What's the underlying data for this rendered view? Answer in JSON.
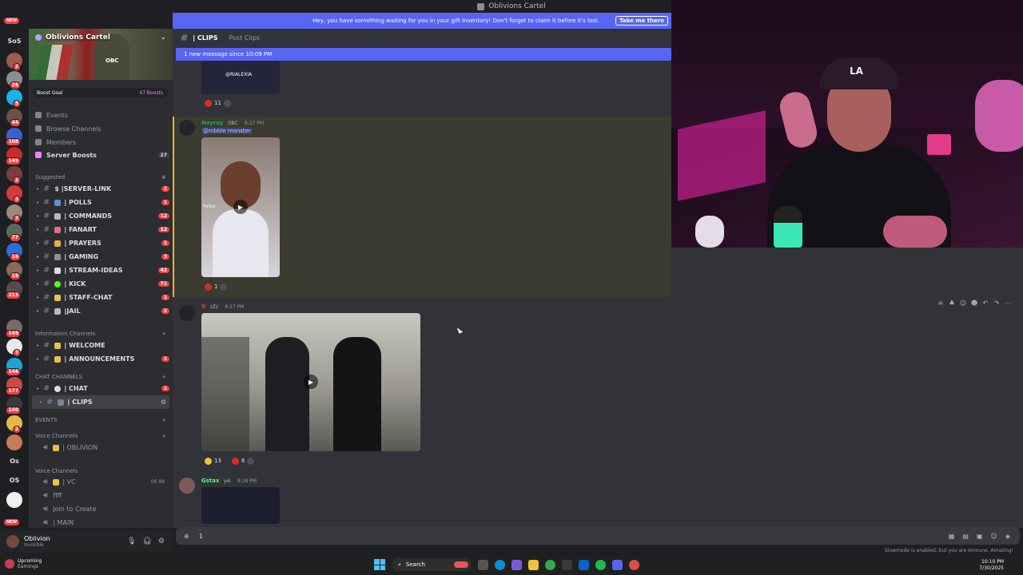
{
  "window": {
    "title": "Oblivions Cartel"
  },
  "rail": {
    "new_top": "NEW",
    "sos": "SoS",
    "badges": [
      "2",
      "26",
      "5",
      "44",
      "108",
      "149",
      "2",
      "3",
      "3",
      "77",
      "16",
      "19",
      "213",
      "149",
      "3",
      "146",
      "177",
      "140",
      "2"
    ],
    "os1": "Os",
    "os2": "OS",
    "new_bottom": "NEW"
  },
  "server": {
    "name": "Oblivions Cartel",
    "banner_text": "OBC",
    "boost_goal": "Boost Goal",
    "boost_count": "47 Boosts"
  },
  "menu": [
    {
      "label": "Events"
    },
    {
      "label": "Browse Channels"
    },
    {
      "label": "Members"
    },
    {
      "label": "Server Boosts",
      "count": "27"
    }
  ],
  "suggested_header": "Suggested",
  "suggested": [
    {
      "label": "$ |SERVER-LINK",
      "badge": "1"
    },
    {
      "label": "| POLLS",
      "badge": "1"
    },
    {
      "label": "| COMMANDS",
      "badge": "12"
    },
    {
      "label": "| FANART",
      "badge": "12"
    },
    {
      "label": "| PRAYERS",
      "badge": "1"
    },
    {
      "label": "| GAMING",
      "badge": "3"
    },
    {
      "label": "| STREAM-IDEAS",
      "badge": "42"
    },
    {
      "label": "| KICK",
      "badge": "71"
    },
    {
      "label": "| STAFF-CHAT",
      "badge": "1"
    },
    {
      "label": "|JAIL",
      "badge": "2"
    }
  ],
  "info_header": "Information Channels",
  "info": [
    {
      "label": "| WELCOME",
      "badge": ""
    },
    {
      "label": "| ANNOUNCEMENTS",
      "badge": "1"
    }
  ],
  "chat_header": "CHAT CHANNELS",
  "chat": [
    {
      "label": "| CHAT",
      "badge": "1"
    },
    {
      "label": "| CLIPS",
      "badge": ""
    }
  ],
  "events_header": "EVENTS",
  "voice_header_1": "Voice Channels",
  "voice1": [
    {
      "label": "| OBLIVION"
    }
  ],
  "voice_header_2": "Voice Channels",
  "voice2": [
    {
      "label": "| VC",
      "extra": "00  99"
    },
    {
      "label": "ffff"
    },
    {
      "label": "Join to Create"
    },
    {
      "label": "| MAIN"
    }
  ],
  "user": {
    "name": "Oblivion",
    "status": "Invisible"
  },
  "header": {
    "channel": "| CLIPS",
    "sub": "Post Clips"
  },
  "gift_notice": {
    "text": "Hey, you have something waiting for you in your gift inventory! Don't forget to claim it before it's lost.",
    "button": "Take me there"
  },
  "new_message": "1 new message since 10:09 PM",
  "messages": [
    {
      "thumb_text": "@RIALEXIA",
      "reaction_count": "11"
    },
    {
      "author": "Nayray",
      "tag": "OBC",
      "time": "9:27 PM",
      "mention": "@nibble monster",
      "reaction_count": "1",
      "overlay_text": "TikTok"
    },
    {
      "author": "X",
      "tag": "zZz",
      "time": "9:27 PM",
      "reaction_1": "13",
      "reaction_2": "6"
    },
    {
      "author": "Gstax",
      "tag": "yel",
      "time": "9:28 PM"
    }
  ],
  "input": {
    "value": "1"
  },
  "slowmode": "Slowmode is enabled, but you are immune. Amazing!",
  "taskbar": {
    "weather_title": "Upcoming",
    "weather_sub": "Earnings",
    "search": "Search",
    "time": "10:10 PM",
    "date": "7/30/2025"
  },
  "colors": {
    "accent": "#5865f2",
    "badge": "#f23f42",
    "bg": "#313338",
    "sidebar": "#2b2d31"
  }
}
